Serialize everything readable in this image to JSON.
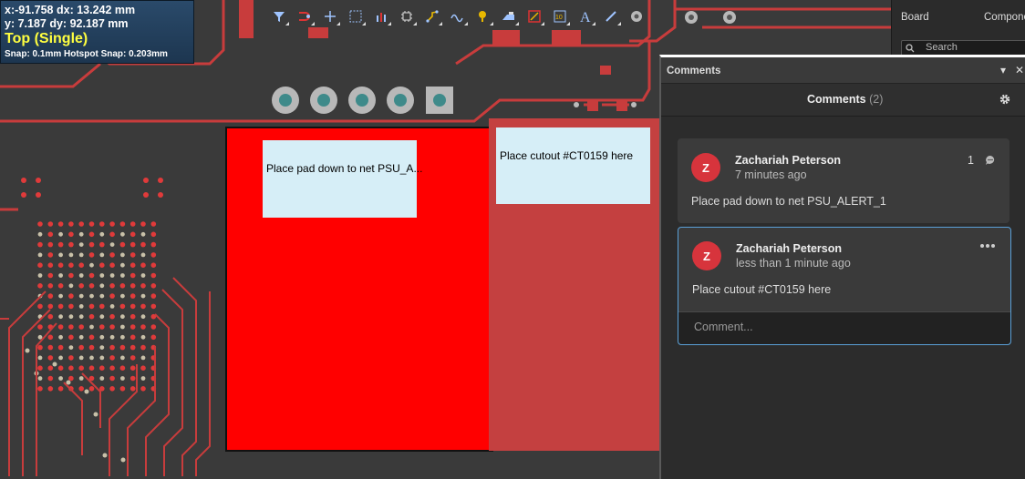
{
  "hud": {
    "line1": "x:-91.758   dx: 13.242 mm",
    "line2": "y:  7.187    dy: 92.187 mm",
    "layer": "Top (Single)",
    "snap": "Snap: 0.1mm Hotspot Snap: 0.203mm"
  },
  "toolbar": {
    "icons": [
      "filter-icon",
      "route-icon",
      "cross-icon",
      "select-rect-icon",
      "chart-icon",
      "component-icon",
      "track-icon",
      "diff-pair-icon",
      "polygon-icon",
      "fill-icon",
      "region-icon",
      "dimension-icon",
      "text-icon",
      "line-icon",
      "pad-icon"
    ]
  },
  "notes": {
    "note1": "Place pad down to net PSU_A...",
    "note2": "Place cutout #CT0159 here"
  },
  "right_tabs": {
    "board": "Board",
    "components": "Compone",
    "search_placeholder": "Search"
  },
  "panel": {
    "title": "Comments",
    "header": "Comments",
    "count": "(2)",
    "comments": [
      {
        "initial": "Z",
        "author": "Zachariah Peterson",
        "time": "7 minutes ago",
        "text": "Place pad down to net PSU_ALERT_1",
        "reply_count": "1"
      },
      {
        "initial": "Z",
        "author": "Zachariah Peterson",
        "time": "less than 1 minute ago",
        "text": "Place cutout #CT0159 here",
        "reply_placeholder": "Comment..."
      }
    ]
  },
  "colors": {
    "board": "#3a3a3a",
    "copper": "#ff0000",
    "trace": "#c83c3c",
    "accent": "#5aa0d8",
    "avatar": "#d7343c"
  }
}
